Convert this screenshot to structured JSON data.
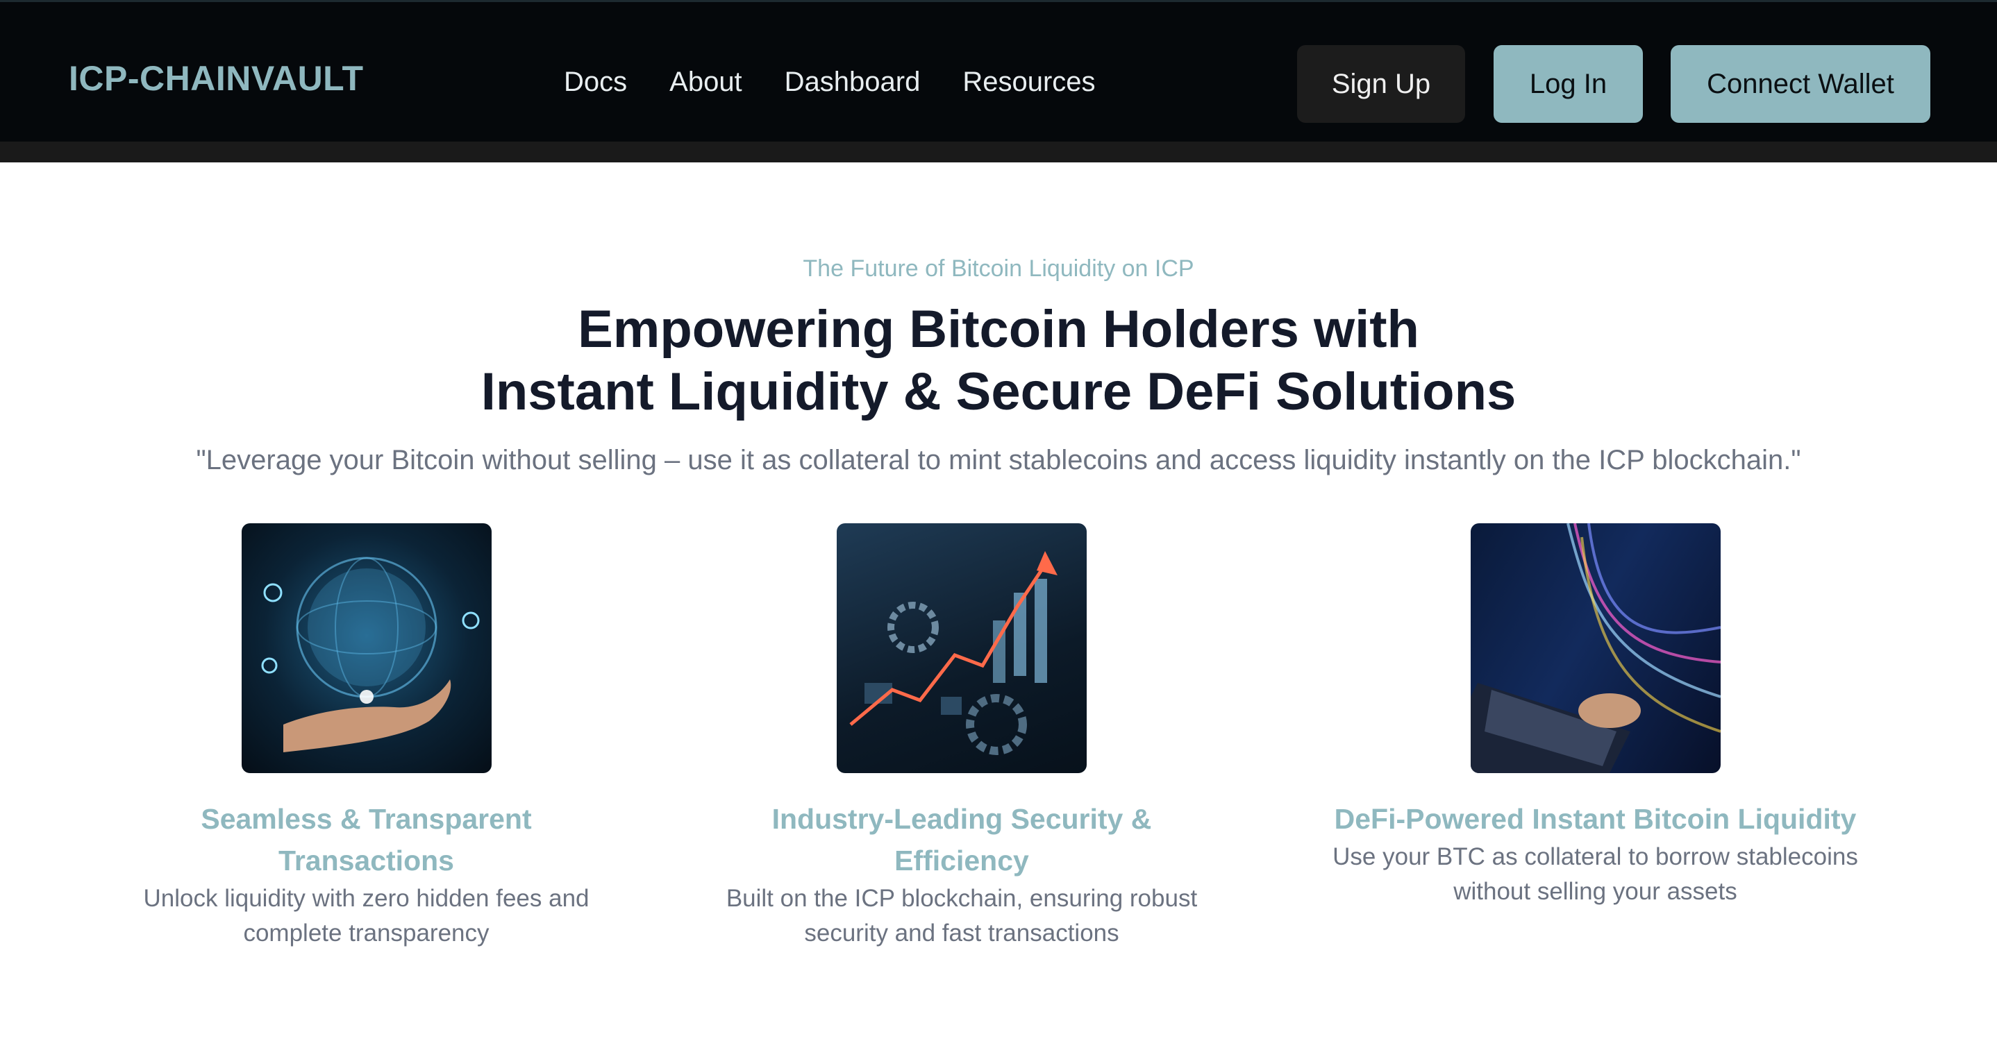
{
  "navbar": {
    "brand": "ICP-CHAINVAULT",
    "links": [
      "Docs",
      "About",
      "Dashboard",
      "Resources"
    ],
    "signup_label": "Sign Up",
    "login_label": "Log In",
    "wallet_label": "Connect Wallet"
  },
  "hero": {
    "eyebrow": "The Future of Bitcoin Liquidity on ICP",
    "title_line1": "Empowering Bitcoin Holders with",
    "title_line2": "Instant Liquidity & Secure DeFi Solutions",
    "quote": "\"Leverage your Bitcoin without selling – use it as collateral to mint stablecoins and access liquidity instantly on the ICP blockchain.\""
  },
  "features": [
    {
      "title_line1": "Seamless & Transparent",
      "title_line2": "Transactions",
      "desc_line1": "Unlock liquidity with zero hidden fees and",
      "desc_line2": "complete transparency"
    },
    {
      "title_line1": "Industry-Leading Security & Efficiency",
      "desc_line1": "Built on the ICP blockchain, ensuring robust",
      "desc_line2": "security and fast transactions"
    },
    {
      "title_line1": "DeFi-Powered Instant Bitcoin Liquidity",
      "desc_line1": "Use your BTC as collateral to borrow stablecoins",
      "desc_line2": "without selling your assets"
    }
  ],
  "colors": {
    "accent": "#8fb8bf",
    "navbar_bg": "#05080b",
    "heading": "#141a2a",
    "body_text": "#6b7280"
  }
}
